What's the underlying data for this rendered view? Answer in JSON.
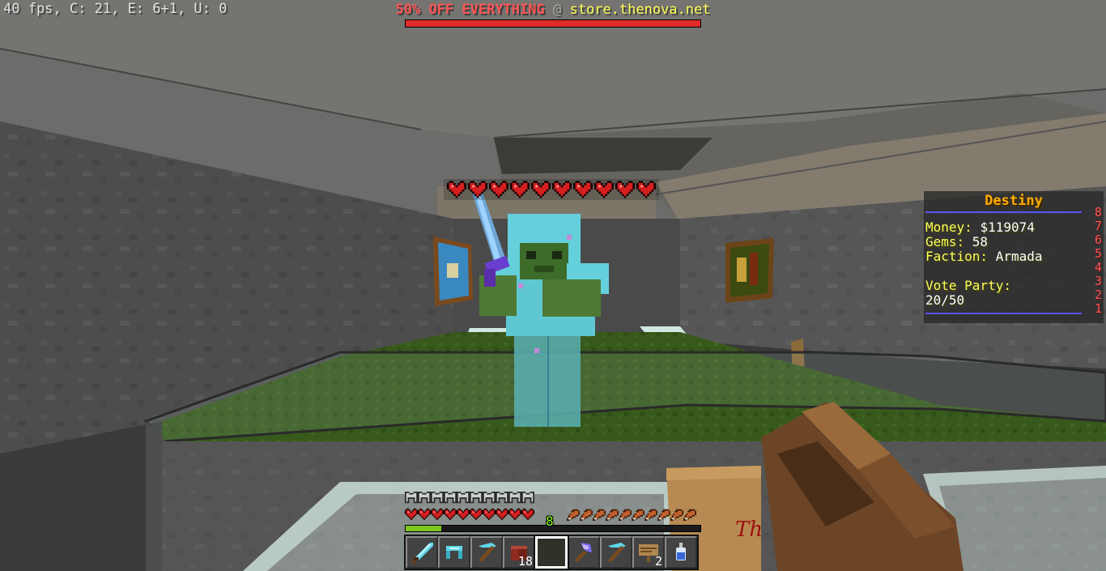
{
  "debug": {
    "text": "40 fps, C: 21, E: 6+1, U: 0"
  },
  "bossbar": {
    "promo": "50% OFF EVERYTHING",
    "separator": "@",
    "store": "store.thenova.net",
    "progress": 1.0,
    "color": "#e12b2b"
  },
  "scoreboard": {
    "title": "Destiny",
    "lines": [
      {
        "key": "Money: ",
        "value": "$119074"
      },
      {
        "key": "Gems: ",
        "value": "58"
      },
      {
        "key": "Faction: ",
        "value": "Armada"
      },
      {
        "key": "",
        "value": ""
      },
      {
        "key": "Vote Party:",
        "value": ""
      },
      {
        "key": "",
        "value": "20/50"
      }
    ],
    "scores": [
      "8",
      "7",
      "6",
      "5",
      "4",
      "3",
      "2",
      "1"
    ],
    "title_color": "#ffaa00",
    "key_color": "#ffff55",
    "score_color": "#ff5555"
  },
  "mob": {
    "name": "zombie in diamond armor",
    "hearts": 10,
    "held_item": "enchanted-diamond-sword"
  },
  "hud": {
    "armor_points": 10,
    "health_hearts": 10,
    "food_points": 10,
    "xp_level": "8",
    "xp_progress": 0.12
  },
  "hotbar": {
    "selected_index": 4,
    "slots": [
      {
        "icon": "diamond-sword-icon",
        "count": ""
      },
      {
        "icon": "diamond-helmet-icon",
        "count": ""
      },
      {
        "icon": "diamond-pickaxe-icon",
        "count": ""
      },
      {
        "icon": "nether-brick-block-icon",
        "count": "18"
      },
      {
        "icon": "empty-slot",
        "count": ""
      },
      {
        "icon": "enchanted-diamond-axe-icon",
        "count": ""
      },
      {
        "icon": "diamond-pickaxe-icon",
        "count": ""
      },
      {
        "icon": "oak-sign-icon",
        "count": "2"
      },
      {
        "icon": "potion-bottle-icon",
        "count": ""
      }
    ]
  },
  "scene": {
    "sign_text": "Th"
  }
}
